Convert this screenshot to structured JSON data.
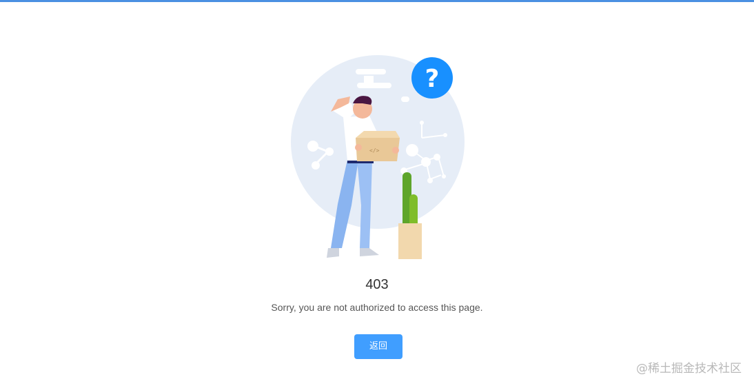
{
  "result": {
    "status_code": "403",
    "subtitle": "Sorry, you are not authorized to access this page.",
    "back_button_label": "返回",
    "illustration_icon": "question-mark-icon"
  },
  "watermark": {
    "text": "@稀土掘金技术社区"
  },
  "colors": {
    "top_bar": "#4a90e2",
    "primary_button": "#409eff",
    "question_badge": "#1890ff",
    "illustration_bg_circle": "#e6edf7",
    "cactus": "#5ea52a"
  }
}
